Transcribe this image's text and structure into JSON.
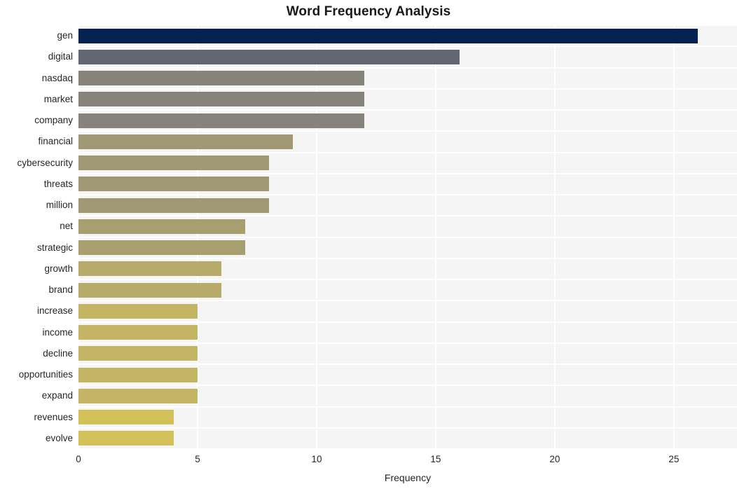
{
  "chart_data": {
    "type": "bar",
    "orientation": "horizontal",
    "title": "Word Frequency Analysis",
    "xlabel": "Frequency",
    "ylabel": "",
    "categories": [
      "gen",
      "digital",
      "nasdaq",
      "market",
      "company",
      "financial",
      "cybersecurity",
      "threats",
      "million",
      "net",
      "strategic",
      "growth",
      "brand",
      "increase",
      "income",
      "decline",
      "opportunities",
      "expand",
      "revenues",
      "evolve"
    ],
    "values": [
      26,
      16,
      12,
      12,
      12,
      9,
      8,
      8,
      8,
      7,
      7,
      6,
      6,
      5,
      5,
      5,
      5,
      5,
      4,
      4
    ],
    "bar_colors": [
      "#052350",
      "#636570",
      "#85837c",
      "#85837c",
      "#85837c",
      "#a09873",
      "#a09873",
      "#a09873",
      "#a09873",
      "#a89f71",
      "#a89f71",
      "#b7ab6b",
      "#b7ab6b",
      "#c3b564",
      "#c3b564",
      "#c3b564",
      "#c3b564",
      "#c3b564",
      "#d1c158",
      "#d1c158"
    ],
    "xlim": [
      0,
      27.65
    ],
    "xticks": [
      0,
      5,
      10,
      15,
      20,
      25
    ],
    "xtick_labels": [
      "0",
      "5",
      "10",
      "15",
      "20",
      "25"
    ],
    "grid": true,
    "grid_color": "#ffffff",
    "plot_background": "#f5f5f5",
    "figure_background": "#ffffff",
    "legend": null
  }
}
